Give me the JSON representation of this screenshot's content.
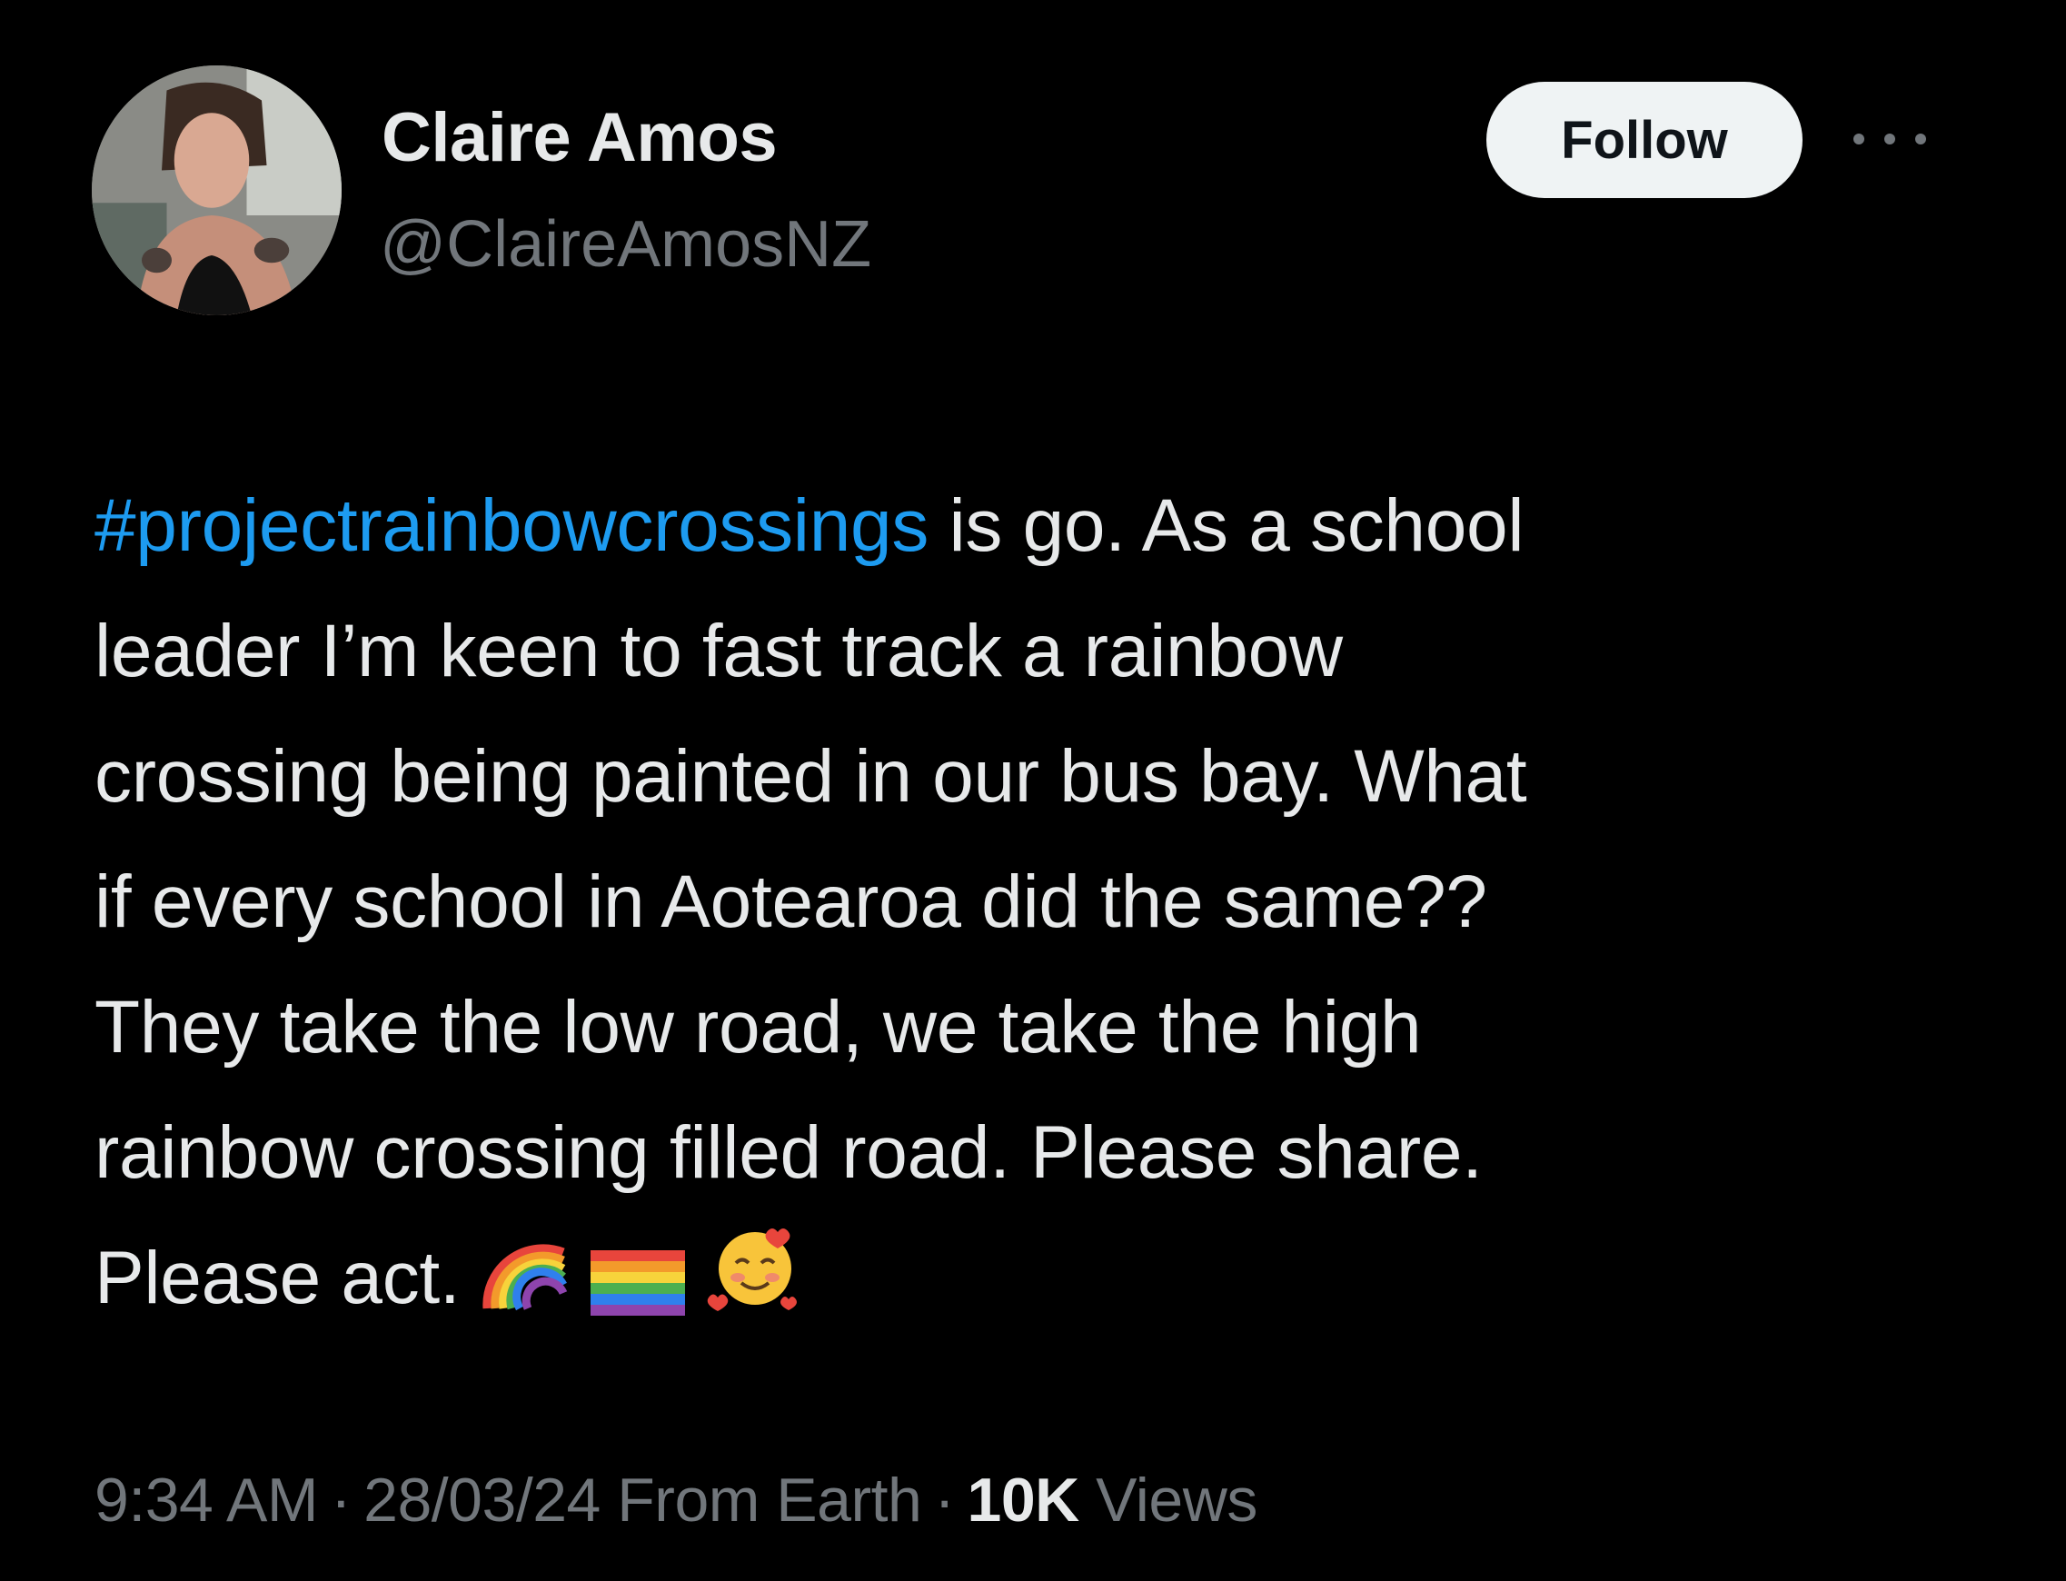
{
  "author": {
    "display_name": "Claire Amos",
    "handle": "@ClaireAmosNZ"
  },
  "actions": {
    "follow_label": "Follow",
    "more_icon": "more-horizontal-icon"
  },
  "tweet": {
    "hashtag": "#projectrainbowcrossings",
    "line1_rest": " is go. As a school",
    "lines": [
      "leader I’m keen to fast track a rainbow",
      "crossing being painted in our bus bay. What",
      "if every school in Aotearoa did the same??",
      "They take the low road, we take the high",
      "rainbow crossing filled road. Please share."
    ],
    "last_line": "Please act.",
    "emojis": [
      "rainbow",
      "rainbow-flag",
      "smiling-face-with-hearts"
    ]
  },
  "meta": {
    "time": "9:34 AM",
    "date": "28/03/24",
    "source": "From Earth",
    "separator": "·",
    "views_count": "10K",
    "views_label": "Views"
  },
  "colors": {
    "background": "#000000",
    "text": "#e7e9ea",
    "secondary": "#71767b",
    "link": "#1d9bf0",
    "follow_bg": "#eff3f4"
  }
}
